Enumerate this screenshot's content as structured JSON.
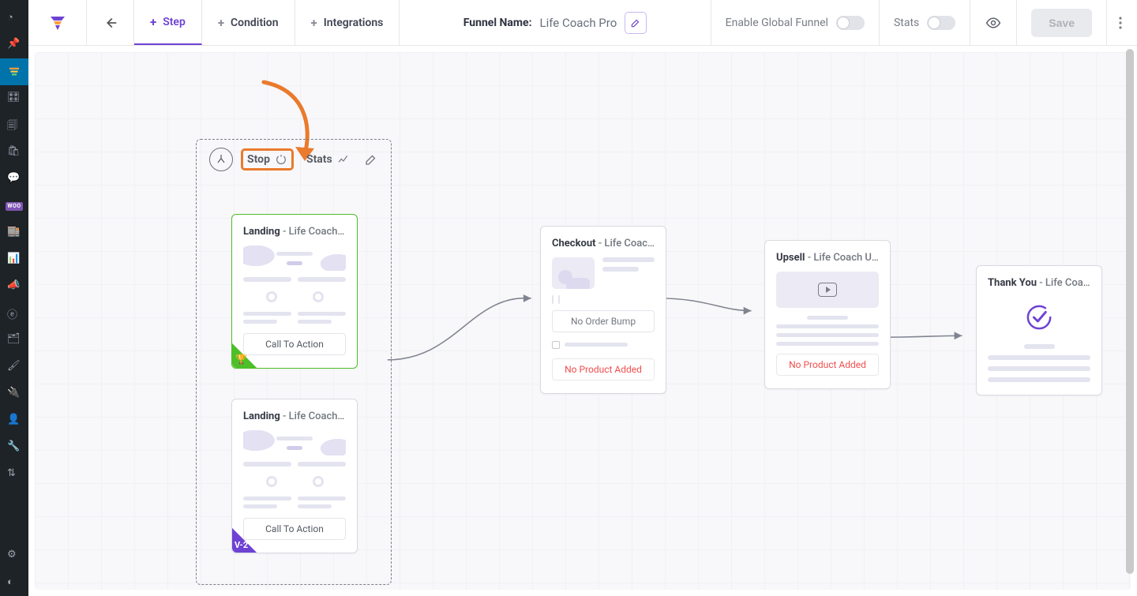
{
  "rail": {
    "items": [
      {
        "name": "dashboard-icon",
        "glyph": "◔"
      },
      {
        "name": "pin-icon",
        "glyph": "📌"
      },
      {
        "name": "funnel-icon",
        "glyph": "▤",
        "highlight": true
      },
      {
        "name": "media-icon",
        "glyph": "🎛"
      },
      {
        "name": "pages-icon",
        "glyph": "🗐"
      },
      {
        "name": "cart-icon",
        "glyph": "🛍"
      },
      {
        "name": "comments-icon",
        "glyph": "💬"
      },
      {
        "name": "woo-icon",
        "glyph": "WOO"
      },
      {
        "name": "store-icon",
        "glyph": "🏬"
      },
      {
        "name": "analytics-icon",
        "glyph": "📊"
      },
      {
        "name": "marketing-icon",
        "glyph": "📣"
      },
      {
        "name": "elementor-icon",
        "glyph": "ⓔ"
      },
      {
        "name": "templates-icon",
        "glyph": "🗂"
      },
      {
        "name": "appearance-icon",
        "glyph": "🖌"
      },
      {
        "name": "plugins-icon",
        "glyph": "🔌"
      },
      {
        "name": "users-icon",
        "glyph": "👤"
      },
      {
        "name": "tools-icon",
        "glyph": "🔧"
      },
      {
        "name": "settings-icon",
        "glyph": "⚙"
      },
      {
        "name": "settings2-icon",
        "glyph": "⚙"
      },
      {
        "name": "collapse-icon",
        "glyph": "◐"
      }
    ]
  },
  "topbar": {
    "tabs": {
      "step": "Step",
      "condition": "Condition",
      "integrations": "Integrations"
    },
    "funnel_label": "Funnel Name:",
    "funnel_name": "Life Coach Pro",
    "enable_global": "Enable Global Funnel",
    "stats": "Stats",
    "save": "Save"
  },
  "abtoolbar": {
    "stop": "Stop",
    "stats": "Stats"
  },
  "nodes": {
    "landing_a": {
      "type": "Landing",
      "name": "- Life Coach Lan…",
      "cta": "Call To Action"
    },
    "landing_b": {
      "type": "Landing",
      "name": "- Life Coach Lan…",
      "cta": "Call To Action",
      "version": "V-2"
    },
    "checkout": {
      "type": "Checkout",
      "name": "- Life Coach Ch…",
      "no_bump": "No Order Bump",
      "no_prod": "No Product Added"
    },
    "upsell": {
      "type": "Upsell",
      "name": "- Life Coach Up…",
      "no_prod": "No Product Added"
    },
    "thankyou": {
      "type": "Thank You",
      "name": "- Life Coach Tha…"
    }
  }
}
